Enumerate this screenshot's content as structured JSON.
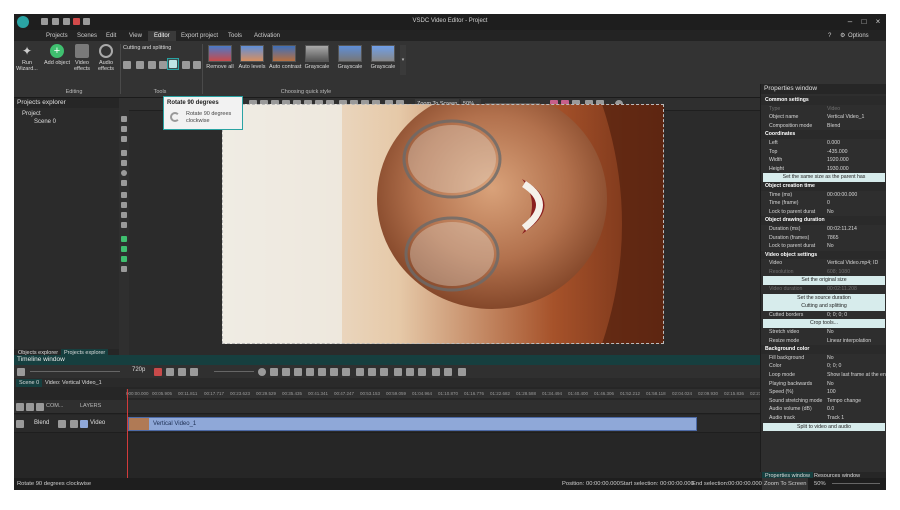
{
  "window": {
    "title": "VSDC Video Editor - Project",
    "options_label": "Options"
  },
  "menu": {
    "items": [
      "Projects",
      "Scenes",
      "Edit",
      "View",
      "Editor",
      "Export project",
      "Tools",
      "Activation"
    ],
    "active": "Editor"
  },
  "ribbon": {
    "run_wizard": "Run Wizard...",
    "add_object": "Add object",
    "video_effects": "Video effects",
    "audio_effects": "Audio effects",
    "editing_group": "Editing",
    "cutting_label": "Cutting and splitting",
    "tools_group": "Tools",
    "quick_styles": [
      "Remove all",
      "Auto levels",
      "Auto contrast",
      "Grayscale",
      "Grayscale",
      "Grayscale"
    ],
    "quick_style_group": "Choosing quick style"
  },
  "tooltip": {
    "title": "Rotate 90 degrees",
    "body": "Rotate 90 degrees clockwise"
  },
  "projects_explorer": {
    "title": "Projects explorer",
    "tree": [
      "Project",
      "Scene 0"
    ],
    "tabs": [
      "Objects explorer",
      "Projects explorer"
    ]
  },
  "canvas_toolbar": {
    "zoom_label": "Zoom To Screen",
    "zoom_value": "50%"
  },
  "properties": {
    "title": "Properties window",
    "rows": [
      {
        "t": "sec",
        "k": "Common settings"
      },
      {
        "t": "dis",
        "k": "Type",
        "v": "Video"
      },
      {
        "k": "Object name",
        "v": "Vertical Video_1"
      },
      {
        "k": "Composition mode",
        "v": "Blend"
      },
      {
        "t": "sec",
        "k": "Coordinates"
      },
      {
        "k": "Left",
        "v": "0.000"
      },
      {
        "k": "Top",
        "v": "-435.000"
      },
      {
        "k": "Width",
        "v": "1920.000"
      },
      {
        "k": "Height",
        "v": "1930.000"
      },
      {
        "t": "btn",
        "k": "Set the same size as the parent has"
      },
      {
        "t": "sec",
        "k": "Object creation time"
      },
      {
        "k": "Time (ms)",
        "v": "00:00:00.000"
      },
      {
        "k": "Time (frame)",
        "v": "0"
      },
      {
        "k": "Lock to parent durat",
        "v": "No"
      },
      {
        "t": "sec",
        "k": "Object drawing duration"
      },
      {
        "k": "Duration (ms)",
        "v": "00:02:11.214"
      },
      {
        "k": "Duration (frames)",
        "v": "7865"
      },
      {
        "k": "Lock to parent durat",
        "v": "No"
      },
      {
        "t": "sec",
        "k": "Video object settings"
      },
      {
        "k": "Video",
        "v": "Vertical Video.mp4; ID"
      },
      {
        "t": "dis",
        "k": "Resolution",
        "v": "608; 1080"
      },
      {
        "t": "btn",
        "k": "Set the original size"
      },
      {
        "t": "dis",
        "k": "Video duration",
        "v": "00:02:11.208"
      },
      {
        "t": "btn",
        "k": "Set the source duration"
      },
      {
        "t": "btn",
        "k": "Cutting and splitting"
      },
      {
        "k": "Cutted borders",
        "v": "0; 0; 0; 0"
      },
      {
        "t": "btn",
        "k": "Crop tools..."
      },
      {
        "k": "Stretch video",
        "v": "No"
      },
      {
        "k": "Resize mode",
        "v": "Linear interpolation"
      },
      {
        "t": "sec",
        "k": "Background color"
      },
      {
        "k": "Fill background",
        "v": "No"
      },
      {
        "k": "Color",
        "v": "0; 0; 0"
      },
      {
        "k": "Loop mode",
        "v": "Show last frame at the en"
      },
      {
        "k": "Playing backwards",
        "v": "No"
      },
      {
        "k": "Speed (%)",
        "v": "100"
      },
      {
        "k": "Sound stretching mode",
        "v": "Tempo change"
      },
      {
        "k": "Audio volume (dB)",
        "v": "0.0"
      },
      {
        "k": "Audio track",
        "v": "Track 1"
      },
      {
        "t": "btn",
        "k": "Split to video and audio"
      }
    ],
    "tabs": [
      "Properties window",
      "Resources window"
    ]
  },
  "timeline": {
    "title": "Timeline window",
    "resolution": "720p",
    "tabs": [
      "Scene 0",
      "Video: Vertical Video_1"
    ],
    "ruler": [
      "000:00.000",
      "00:05.905",
      "00:11.811",
      "00:17.717",
      "00:23.623",
      "00:29.529",
      "00:35.435",
      "00:41.341",
      "00:47.247",
      "00:53.153",
      "00:59.059",
      "01:04.964",
      "01:10.870",
      "01:16.776",
      "01:22.682",
      "01:28.588",
      "01:34.494",
      "01:40.400",
      "01:46.306",
      "01:52.212",
      "01:58.118",
      "02:04.024",
      "02:09.930",
      "02:15.836",
      "02:21.741"
    ],
    "layer_row": {
      "com": "COM...",
      "layers": "LAYERS"
    },
    "track": {
      "blend": "Blend",
      "type": "Video",
      "clip": "Vertical Video_1"
    }
  },
  "status": {
    "left": "Rotate 90 degrees clockwise",
    "position_label": "Position:",
    "position": "00:00:00.000",
    "start_sel_label": "Start selection:",
    "start_sel": "00:00:00.000",
    "end_sel_label": "End selection:",
    "end_sel": "00:00:00.000",
    "zoom_label": "Zoom To Screen",
    "zoom_value": "50%"
  },
  "colors": {
    "accent": "#2aa3a3",
    "timeline_header": "#163f3f",
    "clip": "#8fa8d8"
  }
}
